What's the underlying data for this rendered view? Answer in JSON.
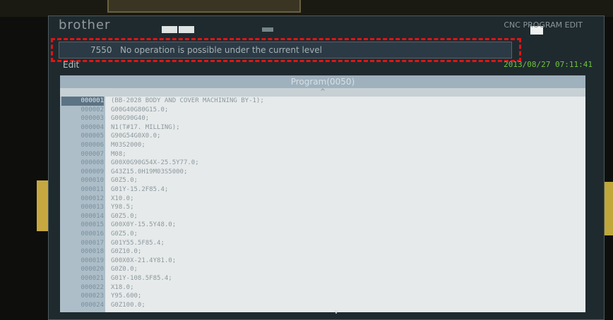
{
  "window": {
    "brand": "brother",
    "mode_label": "CNC PROGRAM EDIT"
  },
  "alarm": {
    "code": "7550",
    "message": "No operation is possible under the current level"
  },
  "status": {
    "mode": "Edit",
    "datetime": "2013/08/27 07:11:41"
  },
  "panel": {
    "title": "Program(0050)",
    "scroll_up": "^",
    "scroll_down": "v"
  },
  "program": {
    "lines": [
      {
        "no": "000001",
        "code": "(BB-2028 BODY AND COVER MACHINING BY-1);"
      },
      {
        "no": "000002",
        "code": "G00G40G80G15.0;"
      },
      {
        "no": "000003",
        "code": "G00G90G40;"
      },
      {
        "no": "000004",
        "code": "N1(T#17. MILLING);"
      },
      {
        "no": "000005",
        "code": "G90G54G0X0.0;"
      },
      {
        "no": "000006",
        "code": "M03S2000;"
      },
      {
        "no": "000007",
        "code": "M08;"
      },
      {
        "no": "000008",
        "code": "G00X0G90G54X-25.5Y77.0;"
      },
      {
        "no": "000009",
        "code": "G43Z15.0H19M03S5000;"
      },
      {
        "no": "000010",
        "code": "G0Z5.0;"
      },
      {
        "no": "000011",
        "code": "G01Y-15.2F85.4;"
      },
      {
        "no": "000012",
        "code": "X10.0;"
      },
      {
        "no": "000013",
        "code": "Y98.5;"
      },
      {
        "no": "000014",
        "code": "G0Z5.0;"
      },
      {
        "no": "000015",
        "code": "G00X0Y-15.5Y48.0;"
      },
      {
        "no": "000016",
        "code": "G0Z5.0;"
      },
      {
        "no": "000017",
        "code": "G01Y55.5F85.4;"
      },
      {
        "no": "000018",
        "code": "G0Z10.0;"
      },
      {
        "no": "000019",
        "code": "G00X0X-21.4Y81.0;"
      },
      {
        "no": "000020",
        "code": "G0Z0.0;"
      },
      {
        "no": "000021",
        "code": "G01Y-108.5F85.4;"
      },
      {
        "no": "000022",
        "code": "X18.0;"
      },
      {
        "no": "000023",
        "code": "Y95.600;"
      },
      {
        "no": "000024",
        "code": "G0Z100.0;"
      }
    ]
  },
  "colors": {
    "alarm_highlight": "#e01414",
    "datetime": "#6fc43e",
    "panel_header": "#9fb1bd"
  }
}
